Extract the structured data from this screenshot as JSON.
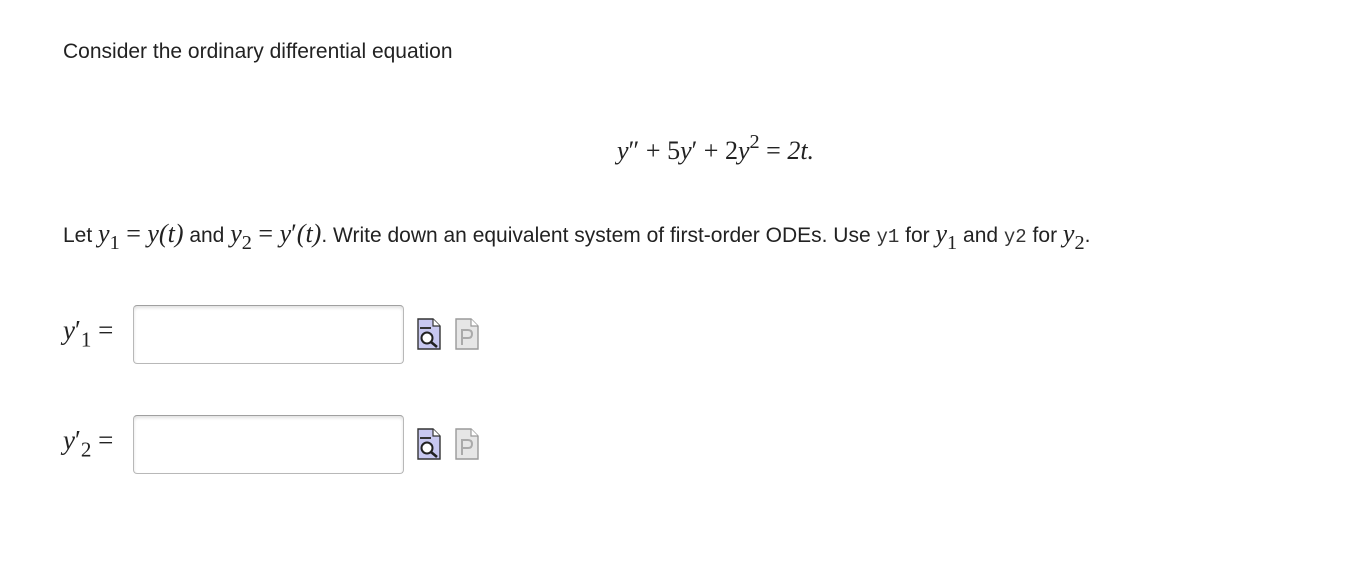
{
  "question": {
    "intro": "Consider the ordinary differential equation",
    "equation": {
      "y_double_prime": "y",
      "primes2": "″",
      "plus1": " + ",
      "coef5": "5",
      "y_prime": "y",
      "prime1": "′",
      "plus2": " + ",
      "coef2": "2",
      "y_sq": "y",
      "exp2": "2",
      "equals": " = ",
      "rhs": "2t."
    },
    "instruction": {
      "let": "Let ",
      "y1_var": "y",
      "y1_sub": "1",
      "eq1": " = ",
      "y_of_t": "y(t)",
      "and1": " and ",
      "y2_var": "y",
      "y2_sub": "2",
      "eq2": " = ",
      "yp_var": "y",
      "yp_prime": "′",
      "yp_arg": "(t)",
      "middle": ". Write down an equivalent system of first-order ODEs. Use ",
      "code_y1": "y1",
      "for1": " for ",
      "y1b_var": "y",
      "y1b_sub": "1",
      "and2": " and ",
      "code_y2": "y2",
      "for2": " for ",
      "y2b_var": "y",
      "y2b_sub": "2",
      "end": "."
    }
  },
  "answers": [
    {
      "lhs_var": "y",
      "lhs_prime": "′",
      "lhs_sub": "1",
      "equals": "=",
      "value": "",
      "placeholder": ""
    },
    {
      "lhs_var": "y",
      "lhs_prime": "′",
      "lhs_sub": "2",
      "equals": "=",
      "value": "",
      "placeholder": ""
    }
  ],
  "icons": {
    "preview": "preview-magnifier-icon",
    "palette": "formula-page-icon",
    "preview_color": "#c8c8f0",
    "palette_color": "#e6e6e6"
  }
}
